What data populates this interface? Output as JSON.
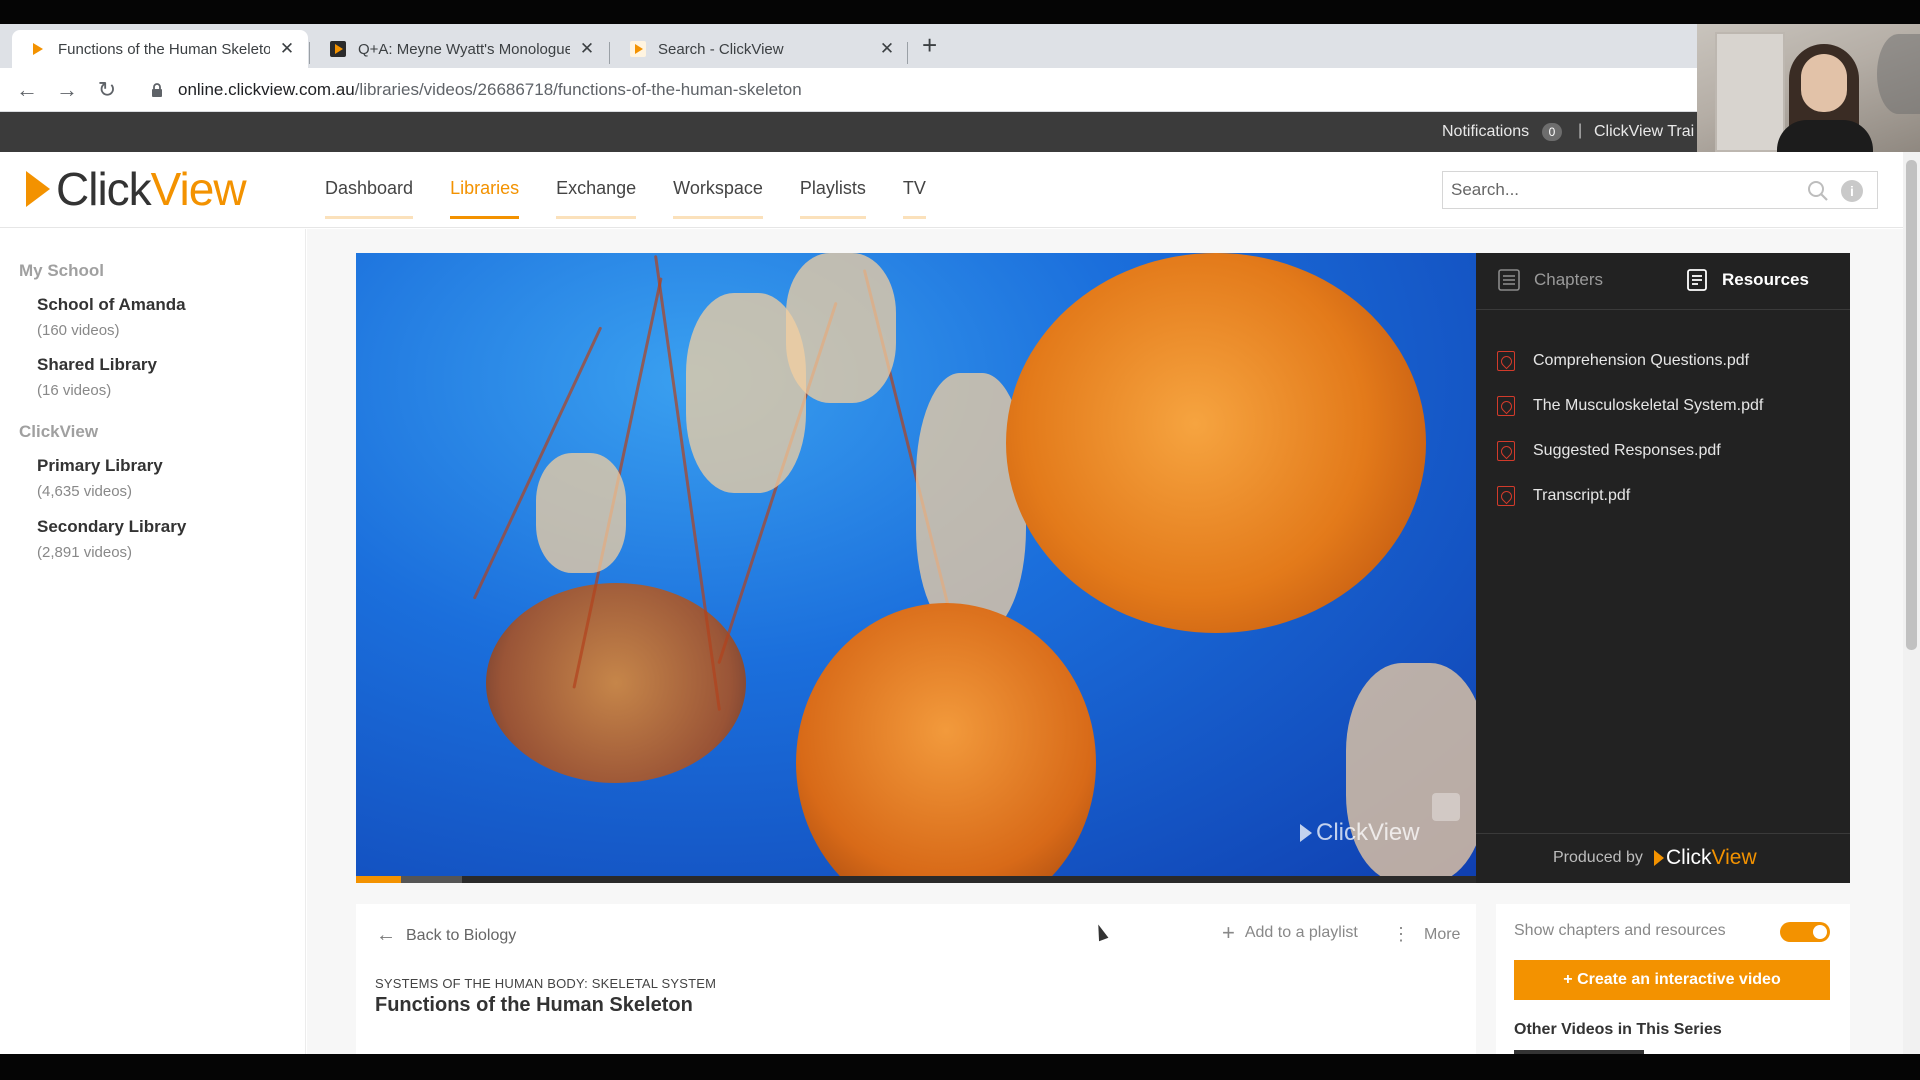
{
  "browser": {
    "tabs": [
      {
        "title": "Functions of the Human Skeleton",
        "close": "✕"
      },
      {
        "title": "Q+A: Meyne Wyatt's Monologue",
        "close": "✕"
      },
      {
        "title": "Search - ClickView",
        "close": "✕"
      }
    ],
    "new_tab": "+",
    "url_host": "online.clickview.com.au",
    "url_path": "/libraries/videos/26686718/functions-of-the-human-skeleton"
  },
  "topbar": {
    "notifications_label": "Notifications",
    "notifications_count": "0",
    "separator": "|",
    "account_label": "ClickView Trai"
  },
  "header": {
    "logo_click": "Click",
    "logo_view": "View",
    "nav": [
      {
        "label": "Dashboard"
      },
      {
        "label": "Libraries"
      },
      {
        "label": "Exchange"
      },
      {
        "label": "Workspace"
      },
      {
        "label": "Playlists"
      },
      {
        "label": "TV"
      }
    ],
    "active_nav": "Libraries",
    "search_placeholder": "Search...",
    "info_glyph": "i"
  },
  "sidebar": {
    "sections": [
      {
        "title": "My School",
        "libraries": [
          {
            "name": "School of Amanda",
            "count": "(160 videos)"
          },
          {
            "name": "Shared Library",
            "count": "(16 videos)"
          }
        ]
      },
      {
        "title": "ClickView",
        "libraries": [
          {
            "name": "Primary Library",
            "count": "(4,635 videos)"
          },
          {
            "name": "Secondary Library",
            "count": "(2,891 videos)"
          }
        ]
      }
    ]
  },
  "player": {
    "watermark": "ClickView",
    "progress_played": 0.04,
    "progress_buffered": 0.095
  },
  "resources": {
    "tab_chapters": "Chapters",
    "tab_resources": "Resources",
    "active_tab": "Resources",
    "files": [
      {
        "name": "Comprehension Questions.pdf"
      },
      {
        "name": "The Musculoskeletal System.pdf"
      },
      {
        "name": "Suggested Responses.pdf"
      },
      {
        "name": "Transcript.pdf"
      }
    ],
    "produced_by": "Produced by",
    "producer_click": "Click",
    "producer_view": "View"
  },
  "video_info": {
    "back_label": "Back to Biology",
    "add_playlist_label": "Add to a playlist",
    "more_label": "More",
    "series": "SYSTEMS OF THE HUMAN BODY: SKELETAL SYSTEM",
    "title": "Functions of the Human Skeleton"
  },
  "side_actions": {
    "show_chapters_label": "Show chapters and resources",
    "show_chapters_on": true,
    "create_button": "+ Create an interactive video",
    "other_videos_label": "Other Videos in This Series"
  },
  "colors": {
    "accent": "#f39200",
    "topbar": "#3b3b3b",
    "panel": "#222222"
  }
}
